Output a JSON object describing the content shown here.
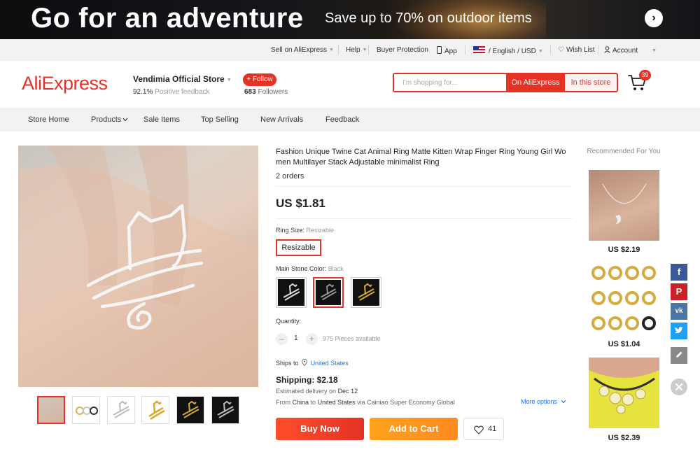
{
  "banner": {
    "title": "Go for an adventure",
    "subtitle": "Save up to 70% on outdoor items",
    "arrow_icon": "chevron-right-icon"
  },
  "topbar": {
    "sell": "Sell on AliExpress",
    "help": "Help",
    "buyer_protection": "Buyer Protection",
    "app": "App",
    "locale": "/ English /",
    "currency": "USD",
    "wish_list": "Wish List",
    "account": "Account"
  },
  "header": {
    "logo": "AliExpress",
    "store_name": "Vendimia Official Store",
    "feedback_pct": "92.1%",
    "feedback_label": "Positive feedback",
    "follow_label": "+ Follow",
    "followers_count": "683",
    "followers_label": "Followers",
    "search_placeholder": "I'm shopping for...",
    "search_on_ali": "On AliExpress",
    "search_in_store": "In this store",
    "cart_count": "39",
    "brand_color": "#e43225"
  },
  "store_nav": {
    "items": [
      "Store Home",
      "Products",
      "Sale Items",
      "Top Selling",
      "New Arrivals",
      "Feedback"
    ]
  },
  "product": {
    "title": "Fashion Unique Twine Cat Animal Ring Matte Kitten Wrap Finger Ring Young Girl Wo men Multilayer Stack Adjustable minimalist Ring",
    "orders": "2 orders",
    "price": "US $1.81",
    "ring_size_label": "Ring Size:",
    "ring_size_value": "Resizable",
    "ring_size_option": "Resizable",
    "stone_color_label": "Main Stone Color:",
    "stone_color_value": "Black",
    "quantity_label": "Quantity:",
    "quantity_value": "1",
    "pieces_available": "975 Pieces available",
    "ships_to_label": "Ships to",
    "ships_to_country": "United States",
    "shipping_cost": "Shipping: $2.18",
    "delivery_prefix": "Estimated delivery on",
    "delivery_date": "Dec 12",
    "from_prefix": "From",
    "from_country": "China",
    "to_word": "to",
    "to_country": "United States",
    "via_text": "via Cainiao Super Economy Global",
    "more_options": "More options",
    "buy_now": "Buy Now",
    "add_to_cart": "Add to Cart",
    "wish_count": "41"
  },
  "recommended": {
    "title": "Recommended For You",
    "items": [
      {
        "price": "US $2.19"
      },
      {
        "price": "US $1.04"
      },
      {
        "price": "US $2.39"
      }
    ]
  },
  "social": [
    "facebook-icon",
    "pinterest-icon",
    "vk-icon",
    "twitter-icon",
    "edit-icon",
    "close-icon"
  ]
}
